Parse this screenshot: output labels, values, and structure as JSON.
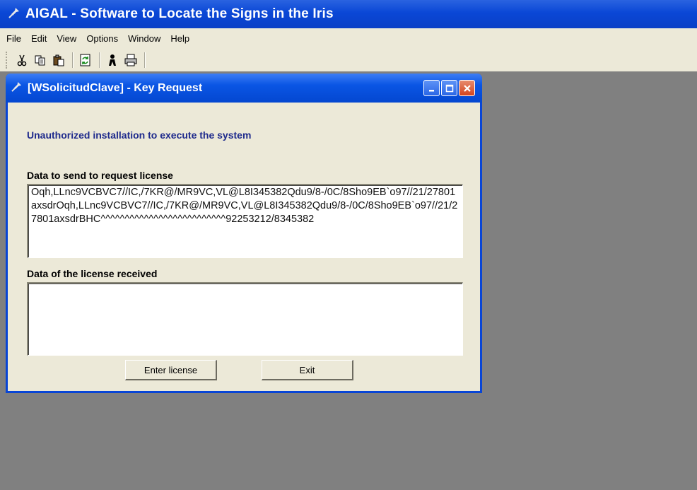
{
  "app": {
    "title": "AIGAL - Software to Locate the Signs in the Iris"
  },
  "menu": {
    "items": [
      "File",
      "Edit",
      "View",
      "Options",
      "Window",
      "Help"
    ]
  },
  "toolbar": {
    "icons": [
      "cut-icon",
      "copy-icon",
      "paste-icon",
      "refresh-icon",
      "user-icon",
      "print-icon"
    ]
  },
  "dialog": {
    "title": "[WSolicitudClave] - Key Request",
    "warning": "Unauthorized installation to execute the system",
    "request_label": "Data to send to request license",
    "request_value": "Oqh,LLnc9VCBVC7//IC,/7KR@/MR9VC,VL@L8I345382Qdu9/8-/0C/8Sho9EB`o97//21/27801axsdrOqh,LLnc9VCBVC7//IC,/7KR@/MR9VC,VL@L8I345382Qdu9/8-/0C/8Sho9EB`o97//21/27801axsdrBHC^^^^^^^^^^^^^^^^^^^^^^^^^^92253212/8345382",
    "received_label": "Data of the license received",
    "received_value": "",
    "enter_button": "Enter license",
    "exit_button": "Exit"
  },
  "colors": {
    "titlebar": "#0a47d6",
    "workspace": "#808080",
    "dialog_face": "#ece9d8",
    "warning_text": "#1e2a8c"
  }
}
